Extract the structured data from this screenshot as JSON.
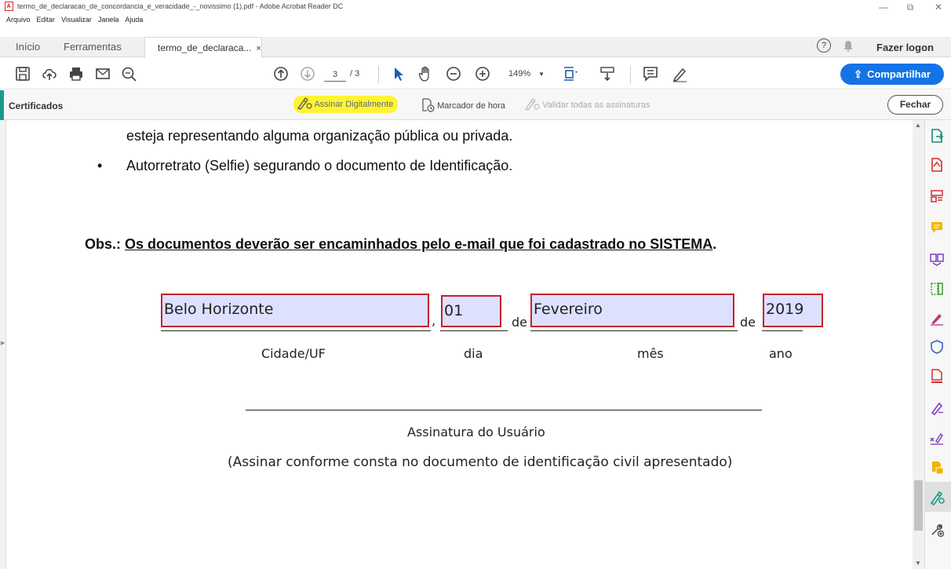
{
  "window": {
    "title": "termo_de_declaracao_de_concordancia_e_veracidade_-_novissimo (1).pdf - Adobe Acrobat Reader DC",
    "minimize": "—",
    "restore": "⧉",
    "close": "✕"
  },
  "menu": [
    "Arquivo",
    "Editar",
    "Visualizar",
    "Janela",
    "Ajuda"
  ],
  "tabs": {
    "home": "Início",
    "tools": "Ferramentas",
    "document": "termo_de_declaraca...",
    "close_glyph": "×"
  },
  "account": {
    "help": "?",
    "login": "Fazer logon"
  },
  "toolbar": {
    "page_current": "3",
    "page_total": "/ 3",
    "zoom": "149%",
    "share": "Compartilhar"
  },
  "certificates": {
    "title": "Certificados",
    "sign_digitally": "Assinar Digitalmente",
    "timestamp": "Marcador de hora",
    "validate_all": "Validar todas as assinaturas",
    "close": "Fechar"
  },
  "document": {
    "line1": "esteja representando alguma organização pública ou privada.",
    "bullet": "•",
    "line2": "Autorretrato (Selfie) segurando o documento de Identificação.",
    "obs_label": "Obs.:",
    "obs_text": "Os documentos deverão ser encaminhados pelo e-mail que foi cadastrado no SISTEMA",
    "obs_end": ".",
    "fields": {
      "city": "Belo Horizonte",
      "day": "01",
      "month": "Fevereiro",
      "year": "2019"
    },
    "comma": ",",
    "de1": "de",
    "de2": "de",
    "labels": {
      "city": "Cidade/UF",
      "day": "dia",
      "month": "mês",
      "year": "ano"
    },
    "signature_label": "Assinatura do Usuário",
    "signature_note": "(Assinar conforme consta no documento de identificação civil apresentado)"
  },
  "colors": {
    "accent_teal": "#199a8b",
    "share_blue": "#1473e6",
    "highlight_yellow": "#fff433",
    "field_border_red": "#c8202a",
    "field_fill": "#dde0ff"
  }
}
